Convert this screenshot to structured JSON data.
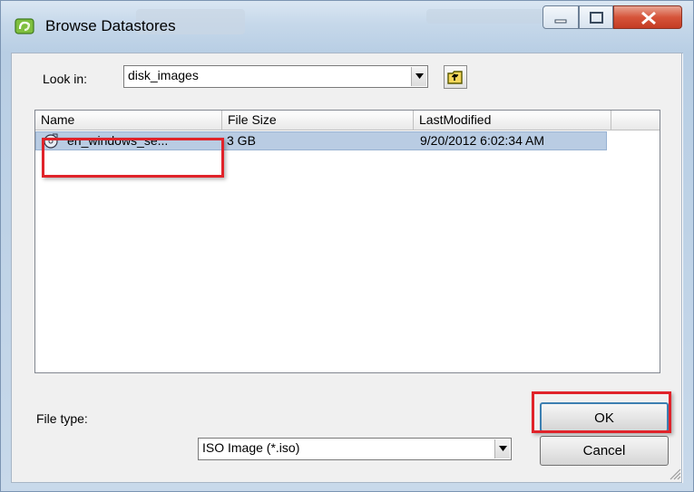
{
  "window": {
    "title": "Browse Datastores",
    "icon": "datastore-icon"
  },
  "look_in": {
    "label": "Look in:",
    "value": "disk_images"
  },
  "columns": [
    "Name",
    "File Size",
    "LastModified"
  ],
  "files": [
    {
      "name": "en_windows_se...",
      "size": "3 GB",
      "modified": "9/20/2012 6:02:34 AM",
      "icon": "disc-icon",
      "selected": true
    }
  ],
  "file_type": {
    "label": "File type:",
    "value": "ISO Image (*.iso)"
  },
  "buttons": {
    "ok": "OK",
    "cancel": "Cancel"
  },
  "colors": {
    "highlight": "#e0232a",
    "selection": "#b9cce3"
  }
}
